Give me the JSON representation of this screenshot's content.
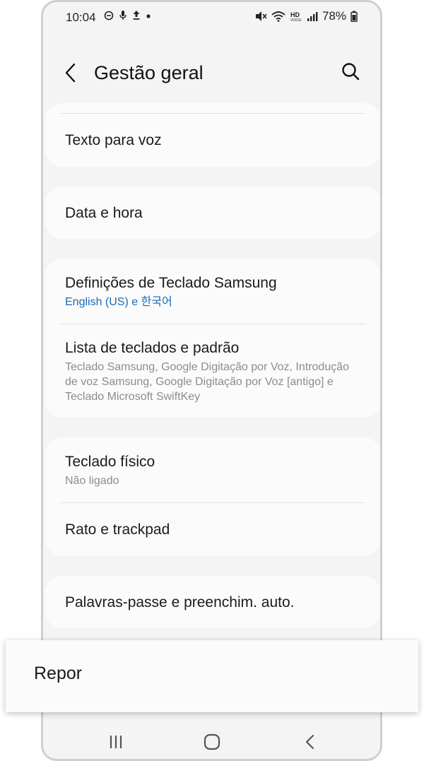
{
  "status_bar": {
    "time": "10:04",
    "battery": "78%",
    "left_icons": [
      "minus-circle-icon",
      "mic-icon",
      "upload-icon",
      "dot-icon"
    ],
    "right_icons": [
      "mute-icon",
      "wifi-icon",
      "hd-voice-icon",
      "signal-icon",
      "battery-icon"
    ]
  },
  "header": {
    "title": "Gestão geral"
  },
  "items": {
    "tts": {
      "title": "Texto para voz"
    },
    "datetime": {
      "title": "Data e hora"
    },
    "samsung_kb": {
      "title": "Definições de Teclado Samsung",
      "subtitle": "English (US) e 한국어"
    },
    "kb_list": {
      "title": "Lista de teclados e padrão",
      "subtitle": "Teclado Samsung, Google Digitação por Voz, Introdução de voz Samsung, Google Digitação por Voz [antigo] e Teclado Microsoft SwiftKey"
    },
    "physical_kb": {
      "title": "Teclado físico",
      "subtitle": "Não ligado"
    },
    "mouse": {
      "title": "Rato e trackpad"
    },
    "passwords": {
      "title": "Palavras-passe e preenchim. auto."
    }
  },
  "popup": {
    "label": "Repor"
  },
  "nav": {
    "icons": [
      "recents-icon",
      "home-icon",
      "back-nav-icon"
    ]
  },
  "colors": {
    "background": "#f4f4f4",
    "card": "#fbfbfb",
    "accent_blue": "#1a6bb8"
  }
}
